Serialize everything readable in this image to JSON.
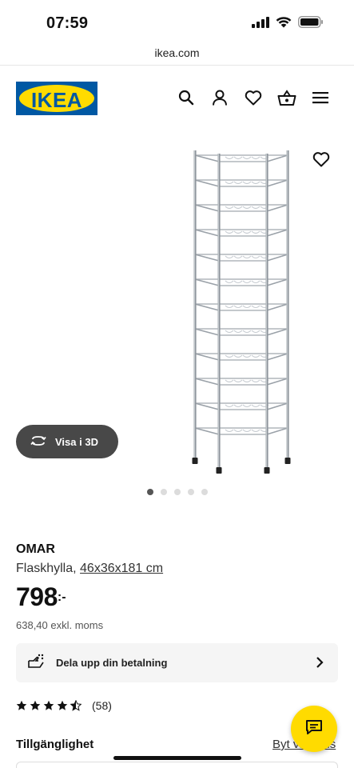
{
  "status_bar": {
    "time": "07:59"
  },
  "browser": {
    "url": "ikea.com"
  },
  "header": {
    "logo_text": "IKEA",
    "icons": [
      "search-icon",
      "user-icon",
      "heart-icon",
      "basket-icon",
      "menu-icon"
    ]
  },
  "colors": {
    "brand_blue": "#0058a3",
    "brand_yellow": "#ffdb00",
    "pill_dark": "#484848"
  },
  "gallery": {
    "view_3d_label": "Visa i 3D",
    "image_count": 5,
    "active_image": 1
  },
  "product": {
    "name": "OMAR",
    "description": "Flaskhylla,",
    "dimensions": "46x36x181 cm",
    "price": "798",
    "price_suffix": ":-",
    "price_excl_vat": "638,40 exkl. moms"
  },
  "payment": {
    "label": "Dela upp din betalning"
  },
  "rating": {
    "stars": 4.5,
    "max": 5,
    "count": "(58)"
  },
  "availability": {
    "title": "Tillgänglighet",
    "change_store_label": "Byt varuhus"
  }
}
